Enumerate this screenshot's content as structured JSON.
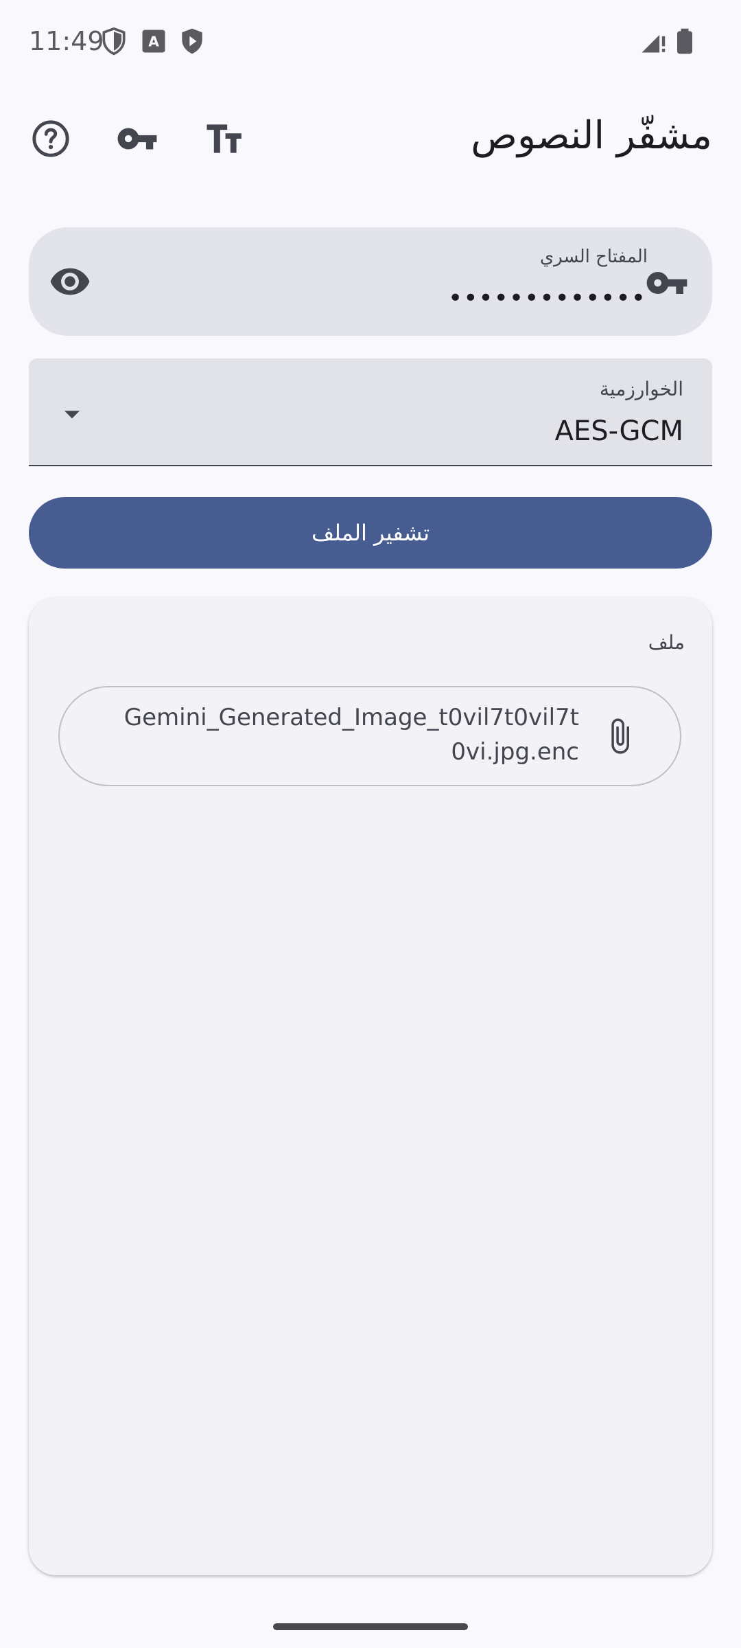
{
  "status_bar": {
    "time": "11:49",
    "icons": [
      "shield-outline-icon",
      "a-box-icon",
      "play-shield-icon",
      "signal-icon",
      "battery-icon"
    ]
  },
  "app_bar": {
    "title": "مشفّر النصوص",
    "actions": [
      "help-icon",
      "key-icon",
      "text-size-icon"
    ]
  },
  "key_field": {
    "label": "المفتاح السري",
    "value": "•••••••••••••",
    "leading_icon": "key-icon",
    "trailing_icon": "eye-icon"
  },
  "algorithm": {
    "label": "الخوارزمية",
    "value": "AES-GCM"
  },
  "encrypt_button": {
    "label": "تشفير الملف"
  },
  "file_card": {
    "label": "ملف",
    "file_name": "Gemini_Generated_Image_t0vil7t0vil7t0vi.jpg.enc"
  },
  "colors": {
    "background": "#F8F8FD",
    "primary": "#475D92",
    "field": "#E3E3EC",
    "card": "#F2F2F7"
  }
}
